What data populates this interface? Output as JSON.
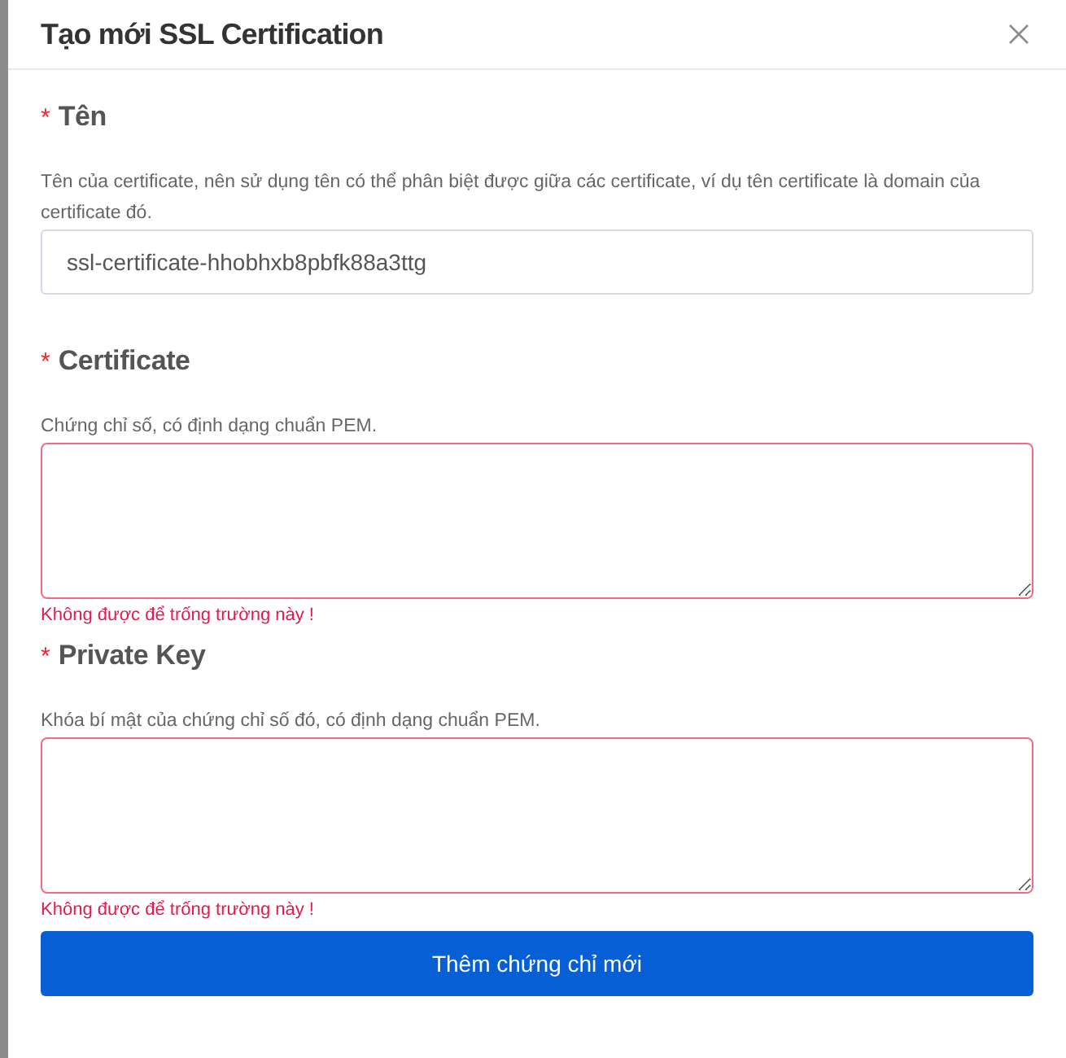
{
  "dialog": {
    "title": "Tạo mới SSL Certification"
  },
  "fields": [
    {
      "kind": "input",
      "required_mark": "*",
      "label": "Tên",
      "description": "Tên của certificate, nên sử dụng tên có thể phân biệt được giữa các certificate, ví dụ tên certificate là domain của certificate đó.",
      "value": "ssl-certificate-hhobhxb8pbfk88a3ttg"
    },
    {
      "kind": "textarea",
      "required_mark": "*",
      "label": "Certificate",
      "description": "Chứng chỉ số, có định dạng chuẩn PEM.",
      "error": "Không được để trống trường này !"
    },
    {
      "kind": "textarea",
      "required_mark": "*",
      "label": "Private Key",
      "description": "Khóa bí mật của chứng chỉ số đó, có định dạng chuẩn PEM.",
      "error": "Không được để trống trường này !"
    }
  ],
  "submit_button": "Thêm chứng chỉ mới"
}
